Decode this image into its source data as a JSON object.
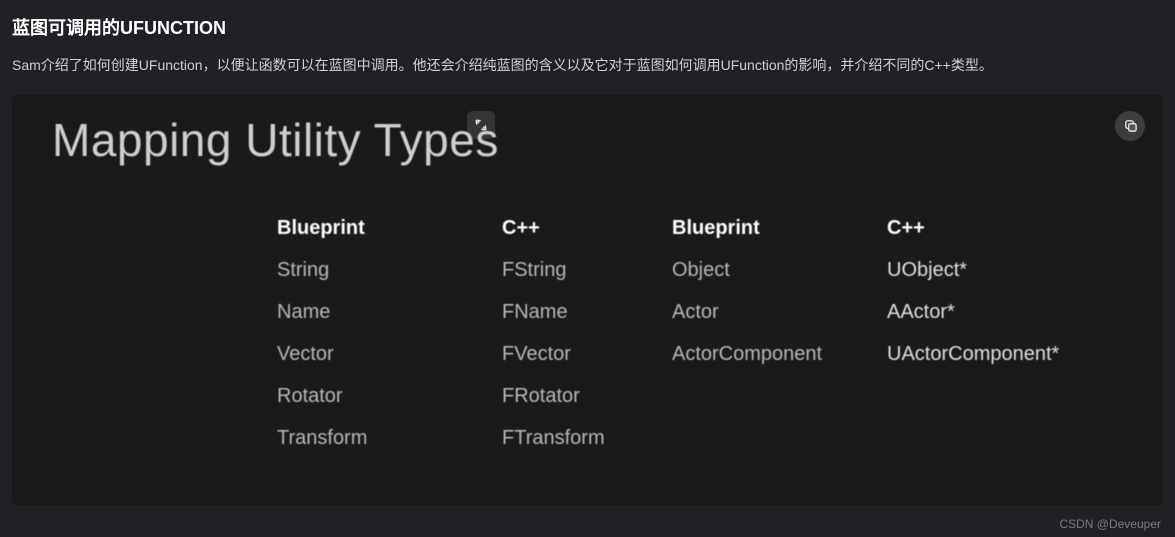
{
  "header": {
    "title": "蓝图可调用的UFUNCTION",
    "description": "Sam介绍了如何创建UFunction，以便让函数可以在蓝图中调用。他还会介绍纯蓝图的含义以及它对于蓝图如何调用UFunction的影响，并介绍不同的C++类型。"
  },
  "slide": {
    "title": "Mapping Utility Types",
    "columns": {
      "left": {
        "header": {
          "bp": "Blueprint",
          "cpp": "C++"
        },
        "rows": [
          {
            "bp": "String",
            "cpp": "FString"
          },
          {
            "bp": "Name",
            "cpp": "FName"
          },
          {
            "bp": "Vector",
            "cpp": "FVector"
          },
          {
            "bp": "Rotator",
            "cpp": "FRotator"
          },
          {
            "bp": "Transform",
            "cpp": "FTransform"
          }
        ]
      },
      "right": {
        "header": {
          "bp": "Blueprint",
          "cpp": "C++"
        },
        "rows": [
          {
            "bp": "Object",
            "cpp": "UObject*"
          },
          {
            "bp": "Actor",
            "cpp": "AActor*"
          },
          {
            "bp": "ActorComponent",
            "cpp": "UActorComponent*"
          }
        ]
      }
    }
  },
  "watermark": "CSDN @Deveuper"
}
